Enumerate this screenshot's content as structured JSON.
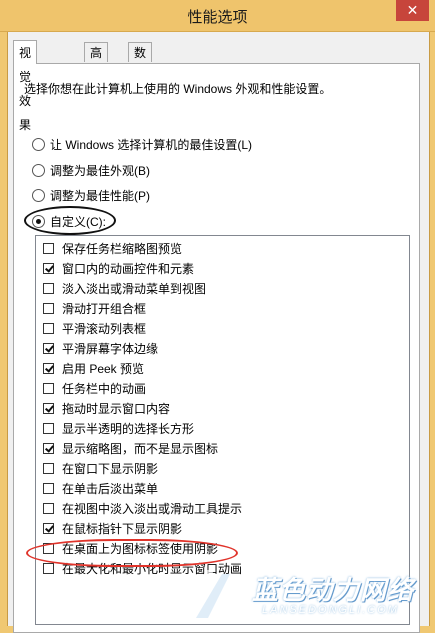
{
  "window": {
    "title": "性能选项",
    "close_glyph": "✕"
  },
  "tabs": [
    {
      "label": "视觉效果",
      "active": true
    },
    {
      "label": "高级",
      "active": false
    },
    {
      "label": "数据执行保护",
      "active": false
    }
  ],
  "description": "选择你想在此计算机上使用的 Windows 外观和性能设置。",
  "radio_options": [
    {
      "label": "让 Windows 选择计算机的最佳设置(L)",
      "selected": false
    },
    {
      "label": "调整为最佳外观(B)",
      "selected": false
    },
    {
      "label": "调整为最佳性能(P)",
      "selected": false
    },
    {
      "label": "自定义(C):",
      "selected": true
    }
  ],
  "effects": [
    {
      "label": "保存任务栏缩略图预览",
      "checked": false
    },
    {
      "label": "窗口内的动画控件和元素",
      "checked": true
    },
    {
      "label": "淡入淡出或滑动菜单到视图",
      "checked": false
    },
    {
      "label": "滑动打开组合框",
      "checked": false
    },
    {
      "label": "平滑滚动列表框",
      "checked": false
    },
    {
      "label": "平滑屏幕字体边缘",
      "checked": true
    },
    {
      "label": "启用 Peek 预览",
      "checked": true
    },
    {
      "label": "任务栏中的动画",
      "checked": false
    },
    {
      "label": "拖动时显示窗口内容",
      "checked": true
    },
    {
      "label": "显示半透明的选择长方形",
      "checked": false
    },
    {
      "label": "显示缩略图，而不是显示图标",
      "checked": true
    },
    {
      "label": "在窗口下显示阴影",
      "checked": false
    },
    {
      "label": "在单击后淡出菜单",
      "checked": false
    },
    {
      "label": "在视图中淡入淡出或滑动工具提示",
      "checked": false
    },
    {
      "label": "在鼠标指针下显示阴影",
      "checked": true
    },
    {
      "label": "在桌面上为图标标签使用阴影",
      "checked": false
    },
    {
      "label": "在最大化和最小化时显示窗口动画",
      "checked": false
    }
  ],
  "watermark": {
    "text": "蓝色动力网络",
    "subtext": "LANSEDONGLI.COM"
  },
  "colors": {
    "title_bar": "#efc46c",
    "close_button": "#c7453b",
    "annotation_red": "#e0332a"
  }
}
